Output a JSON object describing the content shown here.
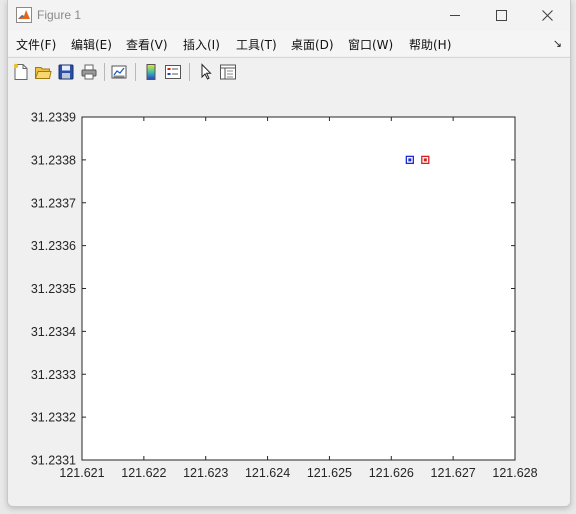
{
  "window": {
    "title": "Figure 1",
    "controls": [
      "minimize",
      "maximize",
      "close"
    ]
  },
  "menubar": {
    "items": [
      "文件(F)",
      "编辑(E)",
      "查看(V)",
      "插入(I)",
      "工具(T)",
      "桌面(D)",
      "窗口(W)",
      "帮助(H)"
    ],
    "overflow_icon": "dock-arrow-icon"
  },
  "toolbar": {
    "buttons": [
      {
        "icon": "new-figure-icon"
      },
      {
        "icon": "open-file-icon"
      },
      {
        "icon": "save-icon"
      },
      {
        "icon": "print-icon"
      },
      {
        "icon": "link-plot-icon"
      },
      {
        "icon": "insert-colorbar-icon"
      },
      {
        "icon": "insert-legend-icon"
      },
      {
        "icon": "edit-plot-arrow-icon"
      },
      {
        "icon": "open-property-inspector-icon"
      }
    ]
  },
  "chart_data": {
    "type": "scatter",
    "xlim": [
      121.621,
      121.628
    ],
    "ylim": [
      31.2331,
      31.2339
    ],
    "xticks": [
      "121.621",
      "121.622",
      "121.623",
      "121.624",
      "121.625",
      "121.626",
      "121.627",
      "121.628"
    ],
    "yticks": [
      "31.2331",
      "31.2332",
      "31.2333",
      "31.2334",
      "31.2335",
      "31.2336",
      "31.2337",
      "31.2338",
      "31.2339"
    ],
    "grid": false,
    "series": [
      {
        "color": "#1c2bd6",
        "marker": "square",
        "points": [
          {
            "x": 121.6263,
            "y": 31.2338
          }
        ]
      },
      {
        "color": "#d42020",
        "marker": "square",
        "points": [
          {
            "x": 121.62655,
            "y": 31.2338
          }
        ]
      }
    ]
  }
}
